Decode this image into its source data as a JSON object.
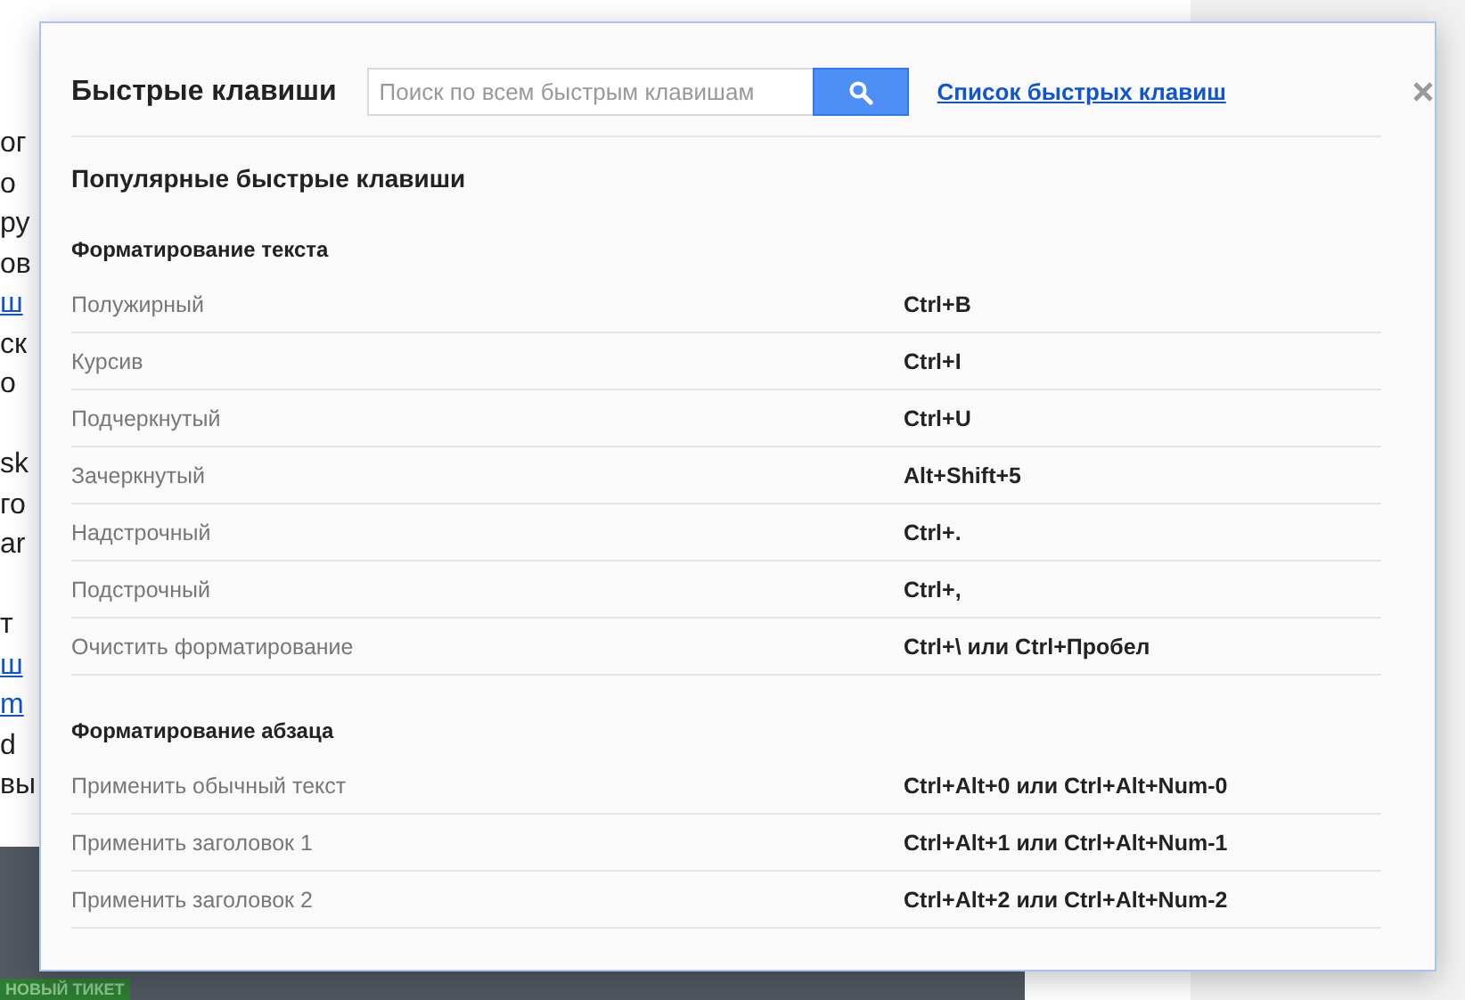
{
  "background": {
    "paragraphs": [
      [
        {
          "text": "ог",
          "link": false
        },
        {
          "text": "о",
          "link": false
        },
        {
          "text": "ру",
          "link": false
        },
        {
          "text": "ов",
          "link": false
        },
        {
          "text": "ш",
          "link": true
        },
        {
          "text": "ск",
          "link": false
        },
        {
          "text": "о",
          "link": false
        }
      ],
      [
        {
          "text": "sk",
          "link": false
        },
        {
          "text": "го",
          "link": false
        },
        {
          "text": "ar",
          "link": false
        }
      ],
      [
        {
          "text": "т",
          "link": false
        },
        {
          "text": "ш",
          "link": true
        },
        {
          "text": "m",
          "link": true
        },
        {
          "text": "d",
          "link": false
        },
        {
          "text": "вы",
          "link": false
        }
      ]
    ],
    "ticket_button": "НОВЫЙ ТИКЕТ"
  },
  "dialog": {
    "title": "Быстрые клавиши",
    "search": {
      "placeholder": "Поиск по всем быстрым клавишам"
    },
    "list_link": "Список быстрых клавиш",
    "heading": "Популярные быстрые клавиши",
    "sections": [
      {
        "title": "Форматирование текста",
        "rows": [
          {
            "action": "Полужирный",
            "keys": "Ctrl+B"
          },
          {
            "action": "Курсив",
            "keys": "Ctrl+I"
          },
          {
            "action": "Подчеркнутый",
            "keys": "Ctrl+U"
          },
          {
            "action": "Зачеркнутый",
            "keys": "Alt+Shift+5"
          },
          {
            "action": "Надстрочный",
            "keys": "Ctrl+."
          },
          {
            "action": "Подстрочный",
            "keys": "Ctrl+,"
          },
          {
            "action": "Очистить форматирование",
            "keys": "Ctrl+\\ или Ctrl+Пробел"
          }
        ]
      },
      {
        "title": "Форматирование абзаца",
        "rows": [
          {
            "action": "Применить обычный текст",
            "keys": "Ctrl+Alt+0 или Ctrl+Alt+Num-0"
          },
          {
            "action": "Применить заголовок 1",
            "keys": "Ctrl+Alt+1 или Ctrl+Alt+Num-1"
          },
          {
            "action": "Применить заголовок 2",
            "keys": "Ctrl+Alt+2 или Ctrl+Alt+Num-2"
          }
        ]
      }
    ]
  }
}
